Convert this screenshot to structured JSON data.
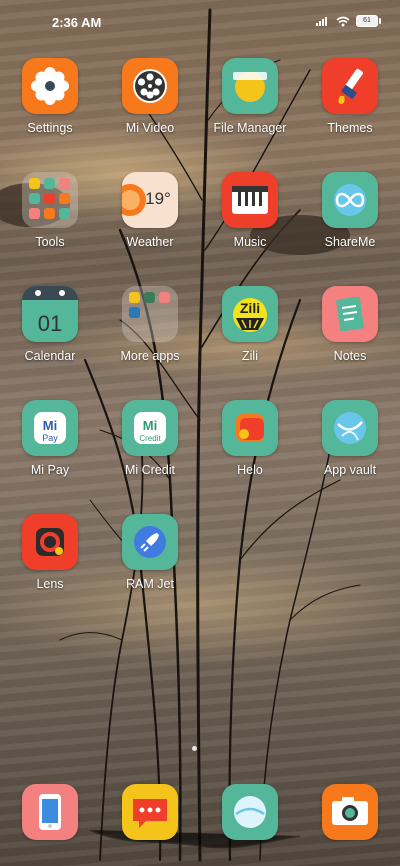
{
  "status_bar": {
    "time": "2:36 AM",
    "battery": "61",
    "icons": [
      "signal-icon",
      "wifi-icon",
      "battery-icon"
    ]
  },
  "apps": {
    "settings": "Settings",
    "mi_video": "Mi Video",
    "file_manager": "File Manager",
    "themes": "Themes",
    "tools": "Tools",
    "weather": "Weather",
    "weather_temp": "19°",
    "music": "Music",
    "shareme": "ShareMe",
    "calendar": "Calendar",
    "calendar_day": "01",
    "more_apps": "More apps",
    "zili": "Zili",
    "zili_logo": "Zili",
    "notes": "Notes",
    "mi_pay": "Mi Pay",
    "mi_credit": "Mi Credit",
    "helo": "Helo",
    "app_vault": "App vault",
    "lens": "Lens",
    "ram_jet": "RAM Jet"
  },
  "dock": [
    "phone-icon",
    "messaging-icon",
    "browser-icon",
    "camera-icon"
  ],
  "colors": {
    "orange": "#f7791c",
    "teal": "#54b79a",
    "red": "#ef3e2a",
    "pink": "#f48080",
    "yellow": "#f4c41a"
  }
}
